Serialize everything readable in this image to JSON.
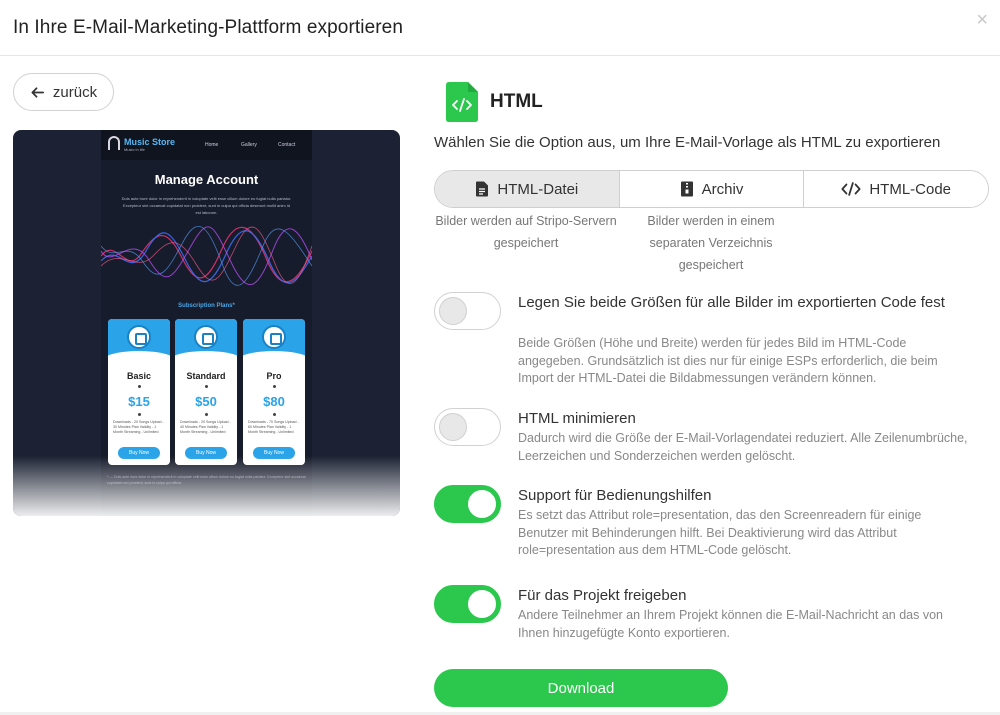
{
  "modal": {
    "title": "In Ihre E-Mail-Marketing-Plattform exportieren",
    "close_symbol": "×",
    "back_label": "zurück"
  },
  "preview": {
    "brand": "Music Store",
    "tagline": "Music in life",
    "nav": [
      "Home",
      "Gallery",
      "Contact"
    ],
    "heading": "Manage Account",
    "intro": "Duis aute irure dolor in reprehenderit in voluptate velit esse cillum dolore eu fugiat nulla pariatur. Excepteur sint occaecat cupidatat non proident, sunt in culpa qui officia deserunt mollit anim id est laborum.",
    "plans_title": "Subscription Plans*",
    "plans": [
      {
        "name": "Basic",
        "price": "$15",
        "features": "Downloads - 20 Songs Upload - 30 Minutes Plan Validity - 1 Month Streaming - Unlimited",
        "button": "Buy Now"
      },
      {
        "name": "Standard",
        "price": "$50",
        "features": "Downloads - 20 Songs Upload - 40 Minutes Plan Validity - 1 Month Streaming - Unlimited",
        "button": "Buy Now"
      },
      {
        "name": "Pro",
        "price": "$80",
        "features": "Downloads - 70 Songs Upload - 60 Minutes Plan Validity - 1 Month Streaming - Unlimited",
        "button": "Buy Now"
      }
    ],
    "footnote": "* — Duis aute irure dolor in reprehenderit in voluptate velit esse cillum dolore eu fugiat nulla pariatur. Excepteur sint occaecat cupidatat non proident, sunt in culpa qui officia."
  },
  "export": {
    "format_title": "HTML",
    "subtitle": "Wählen Sie die Option aus, um Ihre E-Mail-Vorlage als HTML zu exportieren",
    "tabs": [
      {
        "label": "HTML-Datei",
        "desc": "Bilder werden auf Stripo-Servern gespeichert",
        "active": true
      },
      {
        "label": "Archiv",
        "desc": "Bilder werden in einem separaten Verzeichnis gespeichert",
        "active": false
      },
      {
        "label": "HTML-Code",
        "desc": "",
        "active": false
      }
    ],
    "options": [
      {
        "label": "Legen Sie beide Größen für alle Bilder im exportierten Code fest",
        "desc": "Beide Größen (Höhe und Breite) werden für jedes Bild im HTML-Code angegeben. Grundsätzlich ist dies nur für einige ESPs erforderlich, die beim Import der HTML-Datei die Bildabmessungen verändern können.",
        "enabled": false
      },
      {
        "label": "HTML minimieren",
        "desc": "Dadurch wird die Größe der E-Mail-Vorlagendatei reduziert. Alle Zeilenumbrüche, Leerzeichen und Sonderzeichen werden gelöscht.",
        "enabled": false
      },
      {
        "label": "Support für Bedienungshilfen",
        "desc": "Es setzt das Attribut role=presentation, das den Screenreadern für einige Benutzer mit Behinderungen hilft. Bei Deaktivierung wird das Attribut role=presentation aus dem HTML-Code gelöscht.",
        "enabled": true
      },
      {
        "label": "Für das Projekt freigeben",
        "desc": "Andere Teilnehmer an Ihrem Projekt können die E-Mail-Nachricht an das von Ihnen hinzugefügte Konto exportieren.",
        "enabled": true
      }
    ],
    "download_label": "Download"
  },
  "colors": {
    "accent_green": "#2cc84d",
    "preview_blue": "#2aa3e8"
  }
}
